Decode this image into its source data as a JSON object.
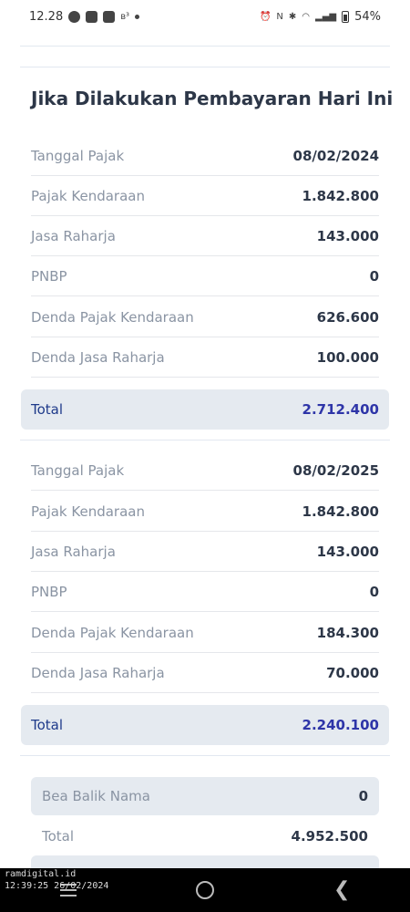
{
  "status_bar": {
    "time": "12.28",
    "network_label": "N",
    "battery_percent": "54%"
  },
  "section": {
    "title": "Jika Dilakukan Pembayaran Hari Ini"
  },
  "payment_2024": {
    "rows": [
      {
        "label": "Tanggal Pajak",
        "value": "08/02/2024"
      },
      {
        "label": "Pajak Kendaraan",
        "value": "1.842.800"
      },
      {
        "label": "Jasa Raharja",
        "value": "143.000"
      },
      {
        "label": "PNBP",
        "value": "0"
      },
      {
        "label": "Denda Pajak Kendaraan",
        "value": "626.600"
      },
      {
        "label": "Denda Jasa Raharja",
        "value": "100.000"
      }
    ],
    "total": {
      "label": "Total",
      "value": "2.712.400"
    }
  },
  "payment_2025": {
    "rows": [
      {
        "label": "Tanggal Pajak",
        "value": "08/02/2025"
      },
      {
        "label": "Pajak Kendaraan",
        "value": "1.842.800"
      },
      {
        "label": "Jasa Raharja",
        "value": "143.000"
      },
      {
        "label": "PNBP",
        "value": "0"
      },
      {
        "label": "Denda Pajak Kendaraan",
        "value": "184.300"
      },
      {
        "label": "Denda Jasa Raharja",
        "value": "70.000"
      }
    ],
    "total": {
      "label": "Total",
      "value": "2.240.100"
    }
  },
  "summary": {
    "bea_balik_nama": {
      "label": "Bea Balik Nama",
      "value": "0"
    },
    "grand_total": {
      "label": "Total",
      "value": "4.952.500"
    }
  },
  "watermark": {
    "site": "ramdigital.id",
    "timestamp": "12:39:25 26/02/2024"
  },
  "colors": {
    "total_bg": "#e5eaf0",
    "total_value": "#2e35a8",
    "label_gray": "#8a94a3"
  }
}
